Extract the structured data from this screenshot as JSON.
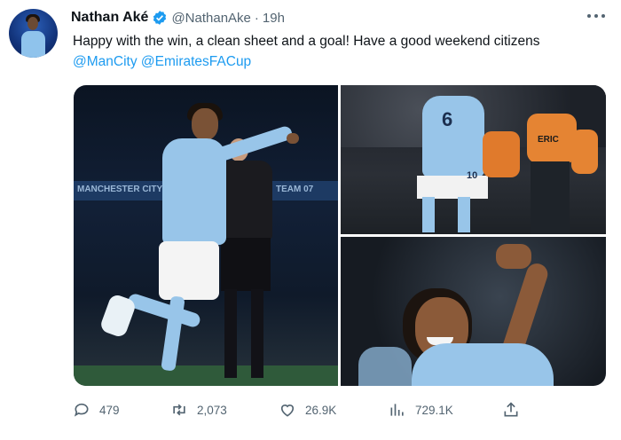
{
  "author": {
    "name": "Nathan Aké",
    "handle": "@NathanAke",
    "separator": "·",
    "time": "19h"
  },
  "tweet": {
    "text_main": "Happy with the win, a clean sheet and a goal! Have a good weekend citizens ",
    "mention_1": "@ManCity",
    "mention_2": "@EmiratesFACup"
  },
  "photos": {
    "p1_board_text_left": "MANCHESTER CITY",
    "p1_board_text_right": "TEAM 07",
    "p2_shirt_number": "6",
    "p2_shirt_number_2": "10",
    "p2_bib_text": "ERIC"
  },
  "actions": {
    "reply_count": "479",
    "retweet_count": "2,073",
    "like_count": "26.9K",
    "view_count": "729.1K"
  },
  "colors": {
    "link": "#1d9bf0",
    "secondary_text": "#536471",
    "city_blue": "#98c5e9"
  },
  "icons": [
    "verified-badge-icon",
    "more-options-icon",
    "reply-icon",
    "retweet-icon",
    "like-icon",
    "views-icon",
    "share-icon"
  ]
}
